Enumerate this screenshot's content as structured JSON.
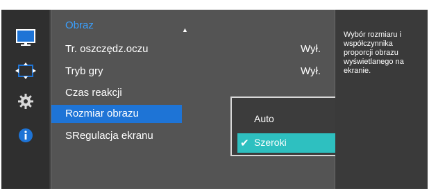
{
  "nav": [
    {
      "icon": "monitor-icon"
    },
    {
      "icon": "resize-arrows-icon"
    },
    {
      "icon": "gear-icon"
    },
    {
      "icon": "info-icon"
    }
  ],
  "menu": {
    "title": "Obraz",
    "scroll_indicator": "▲",
    "items": [
      {
        "label": "Tr. oszczędz.oczu",
        "value": "Wył."
      },
      {
        "label": "Tryb gry",
        "value": "Wył."
      },
      {
        "label": "Czas reakcji",
        "value": ""
      },
      {
        "label": "Rozmiar obrazu",
        "value": ""
      },
      {
        "label": "SRegulacja ekranu",
        "value": ""
      }
    ],
    "selected_index": 3
  },
  "submenu": {
    "options": [
      {
        "label": "Auto",
        "checked": false
      },
      {
        "label": "Szeroki",
        "checked": true
      }
    ],
    "check_glyph": "✔"
  },
  "help": {
    "text": "Wybór rozmiaru i współczynnika proporcji obrazu wyświetlanego na ekranie."
  },
  "colors": {
    "accent_title": "#3aa0ff",
    "selection": "#1e74d6",
    "submenu_highlight": "#2ec0c0"
  }
}
